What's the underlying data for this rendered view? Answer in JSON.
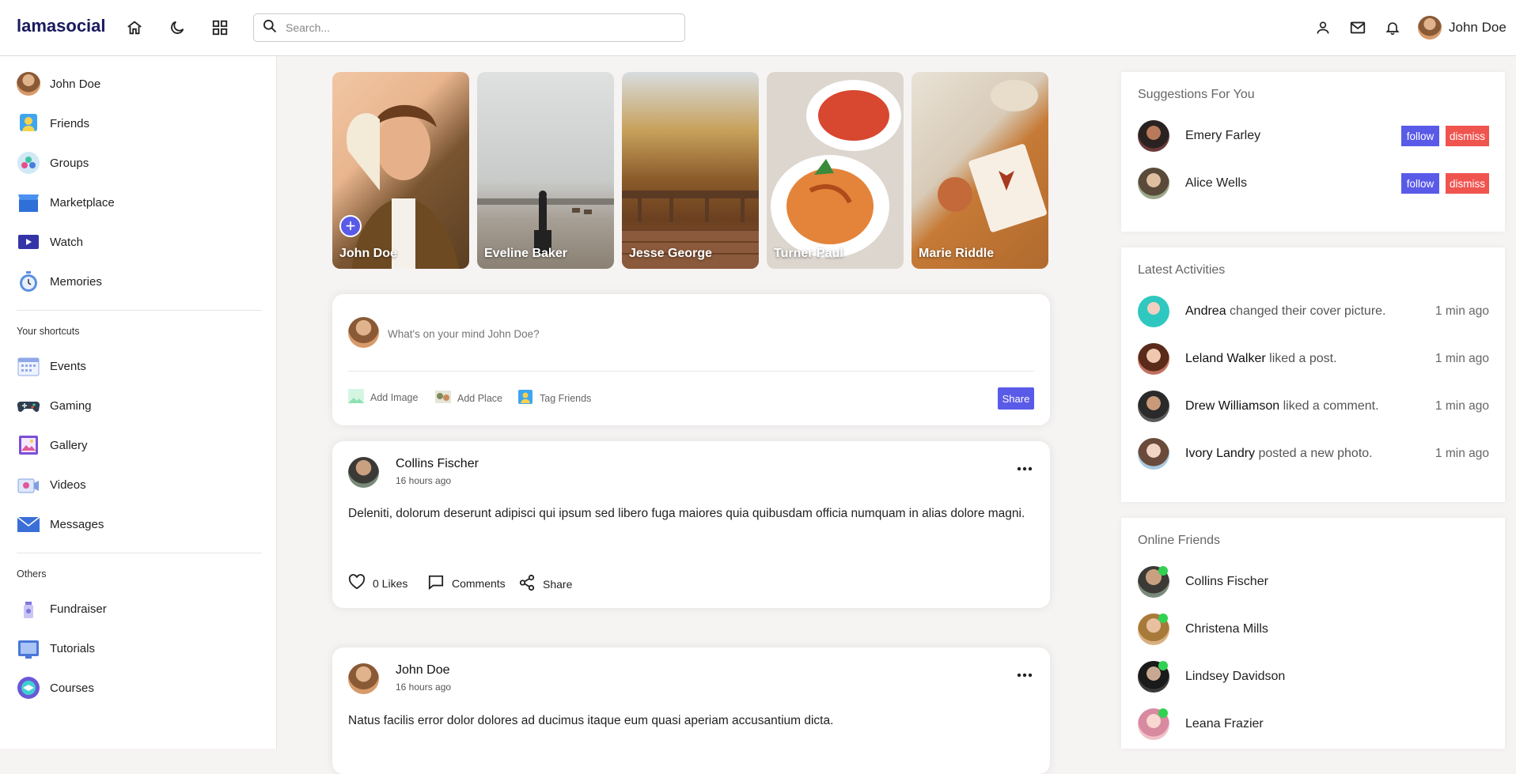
{
  "navbar": {
    "logo": "lamasocial",
    "search_placeholder": "Search...",
    "user_name": "John Doe"
  },
  "leftbar": {
    "menu": [
      {
        "label": "John Doe",
        "icon": "avatar"
      },
      {
        "label": "Friends",
        "icon": "friends-icon"
      },
      {
        "label": "Groups",
        "icon": "groups-icon"
      },
      {
        "label": "Marketplace",
        "icon": "marketplace-icon"
      },
      {
        "label": "Watch",
        "icon": "watch-icon"
      },
      {
        "label": "Memories",
        "icon": "memories-icon"
      }
    ],
    "shortcuts_title": "Your shortcuts",
    "shortcuts": [
      {
        "label": "Events",
        "icon": "events-icon"
      },
      {
        "label": "Gaming",
        "icon": "gaming-icon"
      },
      {
        "label": "Gallery",
        "icon": "gallery-icon"
      },
      {
        "label": "Videos",
        "icon": "videos-icon"
      },
      {
        "label": "Messages",
        "icon": "messages-icon"
      }
    ],
    "others_title": "Others",
    "others": [
      {
        "label": "Fundraiser",
        "icon": "fundraiser-icon"
      },
      {
        "label": "Tutorials",
        "icon": "tutorials-icon"
      },
      {
        "label": "Courses",
        "icon": "courses-icon"
      }
    ]
  },
  "stories": [
    {
      "name": "John Doe"
    },
    {
      "name": "Eveline Baker"
    },
    {
      "name": "Jesse George"
    },
    {
      "name": "Turner Paul"
    },
    {
      "name": "Marie Riddle"
    }
  ],
  "share": {
    "placeholder": "What's on your mind John Doe?",
    "add_image": "Add Image",
    "add_place": "Add Place",
    "tag_friends": "Tag Friends",
    "button": "Share"
  },
  "posts": [
    {
      "user": "Collins Fischer",
      "time": "16 hours ago",
      "text": "Deleniti, dolorum deserunt adipisci qui ipsum sed libero fuga maiores quia quibusdam officia numquam in alias dolore magni.",
      "likes": "0 Likes",
      "comments": "Comments",
      "share": "Share"
    },
    {
      "user": "John Doe",
      "time": "16 hours ago",
      "text": "Natus facilis error dolor dolores ad ducimus itaque eum quasi aperiam accusantium dicta."
    }
  ],
  "suggestions": {
    "title": "Suggestions For You",
    "follow": "follow",
    "dismiss": "dismiss",
    "users": [
      {
        "name": "Emery Farley"
      },
      {
        "name": "Alice Wells"
      }
    ]
  },
  "activities": {
    "title": "Latest Activities",
    "items": [
      {
        "name": "Andrea",
        "action": "changed their cover picture.",
        "time": "1 min ago"
      },
      {
        "name": "Leland Walker",
        "action": "liked a post.",
        "time": "1 min ago"
      },
      {
        "name": "Drew Williamson",
        "action": "liked a comment.",
        "time": "1 min ago"
      },
      {
        "name": "Ivory Landry",
        "action": "posted a new photo.",
        "time": "1 min ago"
      }
    ]
  },
  "online": {
    "title": "Online Friends",
    "friends": [
      {
        "name": "Collins Fischer"
      },
      {
        "name": "Christena Mills"
      },
      {
        "name": "Lindsey Davidson"
      },
      {
        "name": "Leana Frazier"
      }
    ]
  },
  "colors": {
    "accent": "#5a5ae8",
    "dismiss": "#f0544f",
    "online": "#32d152",
    "logo": "#1a1a5e"
  }
}
